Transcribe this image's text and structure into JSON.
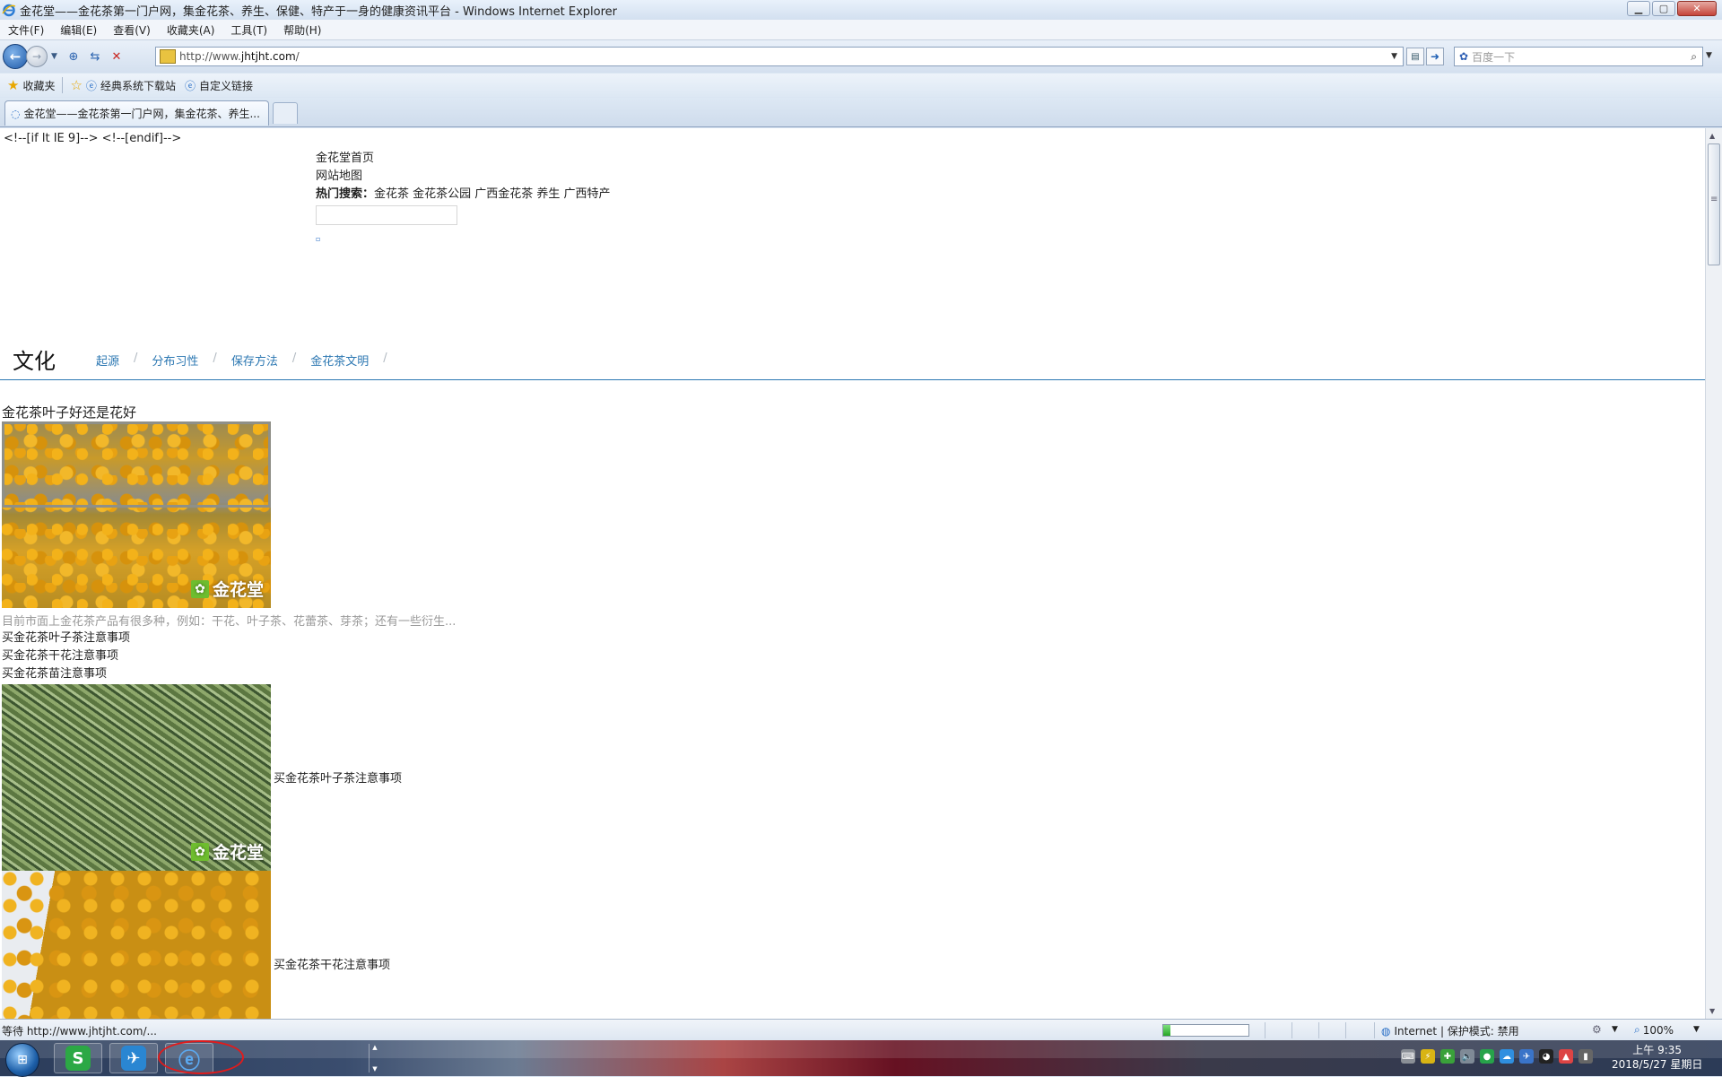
{
  "window": {
    "title": "金花堂——金花茶第一门户网，集金花茶、养生、保健、特产于一身的健康资讯平台 - Windows Internet Explorer",
    "controls": [
      "minimize",
      "maximize",
      "close"
    ]
  },
  "menubar": [
    "文件(F)",
    "编辑(E)",
    "查看(V)",
    "收藏夹(A)",
    "工具(T)",
    "帮助(H)"
  ],
  "address": {
    "prefix": "http://www.",
    "domain": "jhtjht.com",
    "suffix": "/"
  },
  "search": {
    "placeholder": "百度一下"
  },
  "favorites": {
    "label": "收藏夹",
    "items": [
      "经典系统下载站",
      "自定义链接"
    ]
  },
  "tab": {
    "label": "金花堂——金花茶第一门户网，集金花茶、养生..."
  },
  "page": {
    "ie_comment": "<!--[if lt IE 9]--> <!--[endif]-->",
    "home_link": "金花堂首页",
    "sitemap_link": "网站地图",
    "hot_search_label": "热门搜索：",
    "hot_search_terms": "金花茶 金花茶公园 广西金花茶 养生 广西特产",
    "mark": "▫",
    "culture": {
      "title": "文化",
      "nav": [
        "起源",
        "分布习性",
        "保存方法",
        "金花茶文明"
      ],
      "separator": "/"
    },
    "article_title": "金花茶叶子好还是花好",
    "watermark": "金花堂",
    "excerpt": "目前市面上金花茶产品有很多种，例如：干花、叶子茶、花蕾茶、芽茶；还有一些衍生...",
    "list": [
      "买金花茶叶子茶注意事项",
      "买金花茶干花注意事项",
      "买金花茶苗注意事项"
    ],
    "row_labels": [
      "买金花茶叶子茶注意事项",
      "买金花茶干花注意事项"
    ]
  },
  "status": {
    "text": "等待 http://www.jhtjht.com/...",
    "progress": 0.08,
    "zone": "Internet | 保护模式: 禁用",
    "zoom": "100%"
  },
  "taskbar": {
    "apps": [
      "wps-icon",
      "feather-icon",
      "ie-icon"
    ],
    "time": "上午 9:35",
    "date": "2018/5/27 星期日"
  }
}
